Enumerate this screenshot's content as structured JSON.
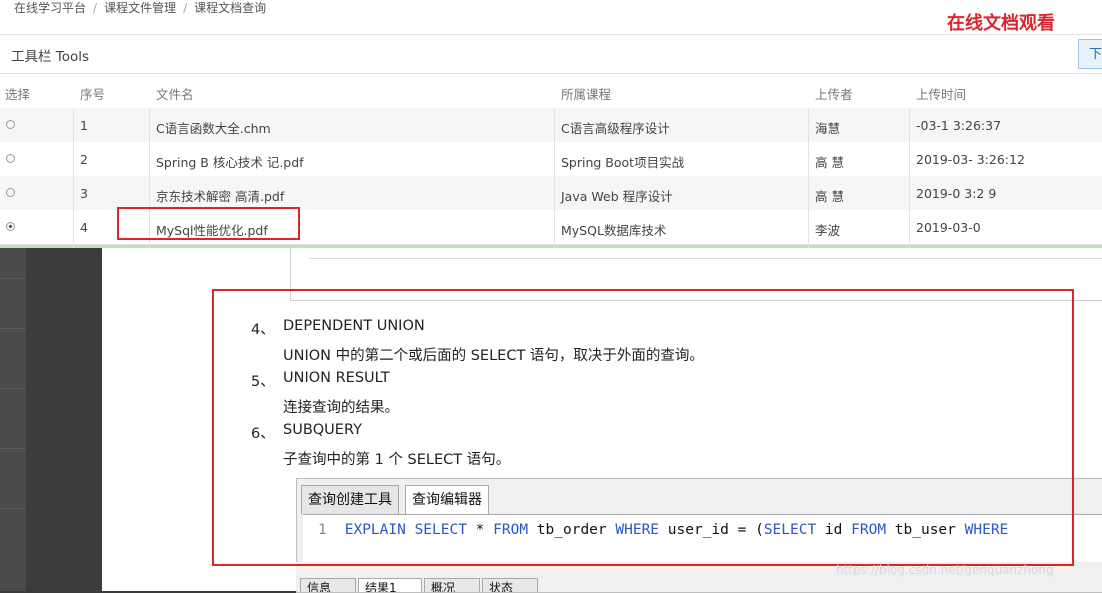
{
  "breadcrumb": [
    "在线学习平台",
    "课程文件管理",
    "课程文档查询"
  ],
  "corner_title": "在线文档观看",
  "toolbar": {
    "label": "工具栏 Tools",
    "download_button": "下"
  },
  "table": {
    "headers": [
      "选择",
      "序号",
      "文件名",
      "所属课程",
      "上传者",
      "上传时间"
    ],
    "rows": [
      {
        "selected": false,
        "index": "1",
        "filename": "C语言函数大全.chm",
        "course": "C语言高级程序设计",
        "uploader": "海慧",
        "time": "-03-1 3:26:37"
      },
      {
        "selected": false,
        "index": "2",
        "filename": "Spring B 核心技术 记.pdf",
        "course": "Spring Boot项目实战",
        "uploader": "高 慧",
        "time": "2019-03- 3:26:12"
      },
      {
        "selected": false,
        "index": "3",
        "filename": "京东技术解密 高清.pdf",
        "course": "Java Web 程序设计",
        "uploader": "高 慧",
        "time": "2019-0 3:2 9"
      },
      {
        "selected": true,
        "index": "4",
        "filename": "MySql性能优化.pdf",
        "course": "MySQL数据库技术",
        "uploader": "李波",
        "time": "2019-03-0"
      }
    ]
  },
  "document": {
    "items": [
      {
        "num": "4、",
        "title": "DEPENDENT UNION",
        "desc": "UNION 中的第二个或后面的 SELECT 语句，取决于外面的查询。"
      },
      {
        "num": "5、",
        "title": "UNION RESULT",
        "desc": "连接查询的结果。"
      },
      {
        "num": "6、",
        "title": "SUBQUERY",
        "desc": "子查询中的第 1 个 SELECT 语句。"
      }
    ],
    "sql_tabs": [
      "查询创建工具",
      "查询编辑器"
    ],
    "sql_line_number": "1",
    "sql_tokens": [
      {
        "t": "EXPLAIN SELECT",
        "kw": true
      },
      {
        "t": " * ",
        "kw": false
      },
      {
        "t": "FROM",
        "kw": true
      },
      {
        "t": " tb_order ",
        "kw": false
      },
      {
        "t": "WHERE",
        "kw": true
      },
      {
        "t": " user_id = (",
        "kw": false
      },
      {
        "t": "SELECT",
        "kw": true
      },
      {
        "t": " id ",
        "kw": false
      },
      {
        "t": "FROM",
        "kw": true
      },
      {
        "t": " tb_user ",
        "kw": false
      },
      {
        "t": "WHERE",
        "kw": true
      }
    ],
    "bottom_tabs": [
      "信息",
      "结果1",
      "概况",
      "状态"
    ],
    "watermark": "https://blog.csdn.net/genquanzhong"
  }
}
